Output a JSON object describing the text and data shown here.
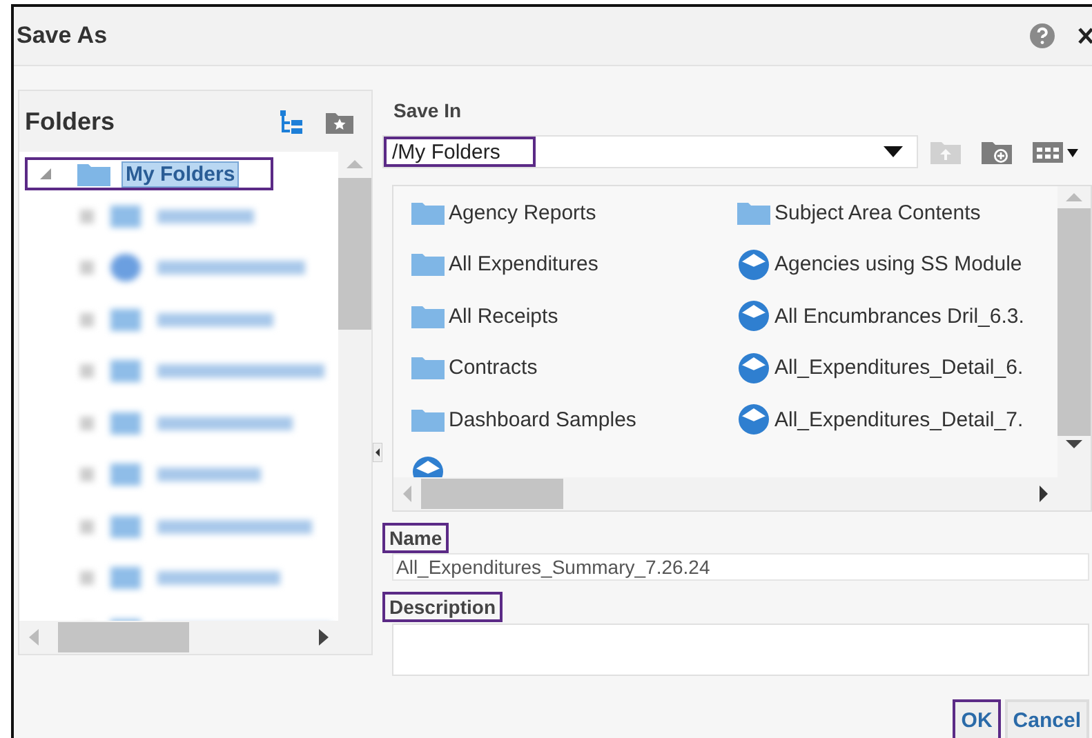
{
  "window": {
    "title": "Save As"
  },
  "folders_panel": {
    "title": "Folders",
    "tree": [
      {
        "label": "My Folders",
        "expanded": true,
        "selected": true,
        "highlighted": true,
        "children": [
          {
            "kind": "folder"
          },
          {
            "kind": "dashboard"
          },
          {
            "kind": "folder"
          },
          {
            "kind": "folder"
          },
          {
            "kind": "folder"
          },
          {
            "kind": "folder"
          },
          {
            "kind": "folder"
          },
          {
            "kind": "folder"
          },
          {
            "kind": "folder"
          }
        ]
      }
    ]
  },
  "save_in": {
    "label": "Save In",
    "value": "/My Folders",
    "highlighted": true
  },
  "toolbar": [
    {
      "kind": "up",
      "disabled": true
    },
    {
      "kind": "new-folder",
      "disabled": false
    },
    {
      "kind": "view",
      "disabled": false
    }
  ],
  "items": [
    {
      "label": "Agency Reports",
      "kind": "folder"
    },
    {
      "label": "Subject Area Contents",
      "kind": "folder"
    },
    {
      "label": "All Expenditures",
      "kind": "folder"
    },
    {
      "label": "Agencies using SS Module",
      "kind": "dashboard"
    },
    {
      "label": "All Receipts",
      "kind": "folder"
    },
    {
      "label": "All Encumbrances Dril_6.3.",
      "kind": "dashboard"
    },
    {
      "label": "Contracts",
      "kind": "folder"
    },
    {
      "label": "All_Expenditures_Detail_6.",
      "kind": "dashboard"
    },
    {
      "label": "Dashboard Samples",
      "kind": "folder"
    },
    {
      "label": "All_Expenditures_Detail_7.",
      "kind": "dashboard"
    },
    {
      "kind": "dashboard"
    }
  ],
  "name": {
    "label": "Name",
    "value": "All_Expenditures_Summary_7.26.24",
    "highlighted": true
  },
  "description": {
    "label": "Description",
    "highlighted": true
  },
  "buttons": [
    {
      "label": "OK",
      "highlighted": true
    },
    {
      "label": "Cancel",
      "highlighted": false
    }
  ]
}
